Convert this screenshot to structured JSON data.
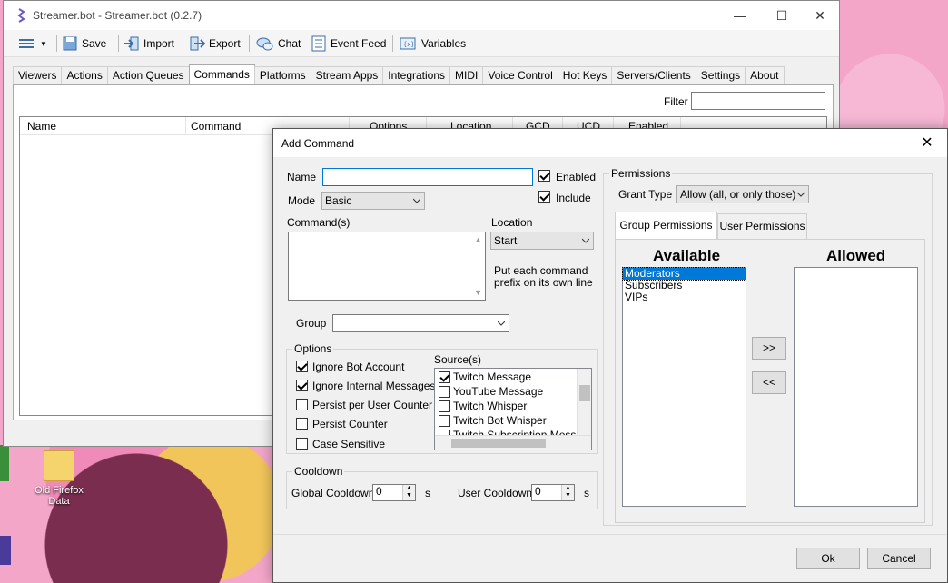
{
  "main": {
    "title": "Streamer.bot - Streamer.bot (0.2.7)",
    "toolbar": {
      "save": "Save",
      "import": "Import",
      "export": "Export",
      "chat": "Chat",
      "event_feed": "Event Feed",
      "variables": "Variables"
    },
    "tabs": [
      "Viewers",
      "Actions",
      "Action Queues",
      "Commands",
      "Platforms",
      "Stream Apps",
      "Integrations",
      "MIDI",
      "Voice Control",
      "Hot Keys",
      "Servers/Clients",
      "Settings",
      "About"
    ],
    "active_tab": "Commands",
    "filter_label": "Filter",
    "columns": [
      "Name",
      "Command",
      "Options",
      "Location",
      "GCD",
      "UCD",
      "Enabled"
    ]
  },
  "desktop": {
    "icon_label": "Old Firefox Data"
  },
  "dialog": {
    "title": "Add Command",
    "name_label": "Name",
    "name_value": "",
    "enabled_label": "Enabled",
    "enabled": true,
    "include_label": "Include",
    "include": true,
    "mode_label": "Mode",
    "mode_value": "Basic",
    "commands_label": "Command(s)",
    "location_label": "Location",
    "location_value": "Start",
    "location_hint": "Put each command prefix on its own line",
    "group_label": "Group",
    "group_value": "",
    "options": {
      "title": "Options",
      "items": [
        {
          "label": "Ignore Bot Account",
          "checked": true
        },
        {
          "label": "Ignore Internal Messages",
          "checked": true
        },
        {
          "label": "Persist per User Counter",
          "checked": false
        },
        {
          "label": "Persist Counter",
          "checked": false
        },
        {
          "label": "Case Sensitive",
          "checked": false
        }
      ],
      "sources_label": "Source(s)",
      "sources": [
        {
          "label": "Twitch Message",
          "checked": true
        },
        {
          "label": "YouTube Message",
          "checked": false
        },
        {
          "label": "Twitch Whisper",
          "checked": false
        },
        {
          "label": "Twitch Bot Whisper",
          "checked": false
        },
        {
          "label": "Twitch Subscription Message",
          "checked": false
        }
      ]
    },
    "cooldown": {
      "title": "Cooldown",
      "global_label": "Global Cooldown",
      "global_value": "0",
      "global_unit": "s",
      "user_label": "User Cooldown",
      "user_value": "0",
      "user_unit": "s"
    },
    "permissions": {
      "title": "Permissions",
      "grant_type_label": "Grant Type",
      "grant_type_value": "Allow (all, or only those)",
      "tabs": [
        "Group Permissions",
        "User Permissions"
      ],
      "available_label": "Available",
      "allowed_label": "Allowed",
      "available": [
        "Moderators",
        "Subscribers",
        "VIPs"
      ],
      "selected_index": 0,
      "allowed": [],
      "add_label": ">>",
      "remove_label": "<<"
    },
    "ok_label": "Ok",
    "cancel_label": "Cancel"
  },
  "colors": {
    "accent": "#0078d7",
    "window_bg": "#f0f0f0"
  }
}
